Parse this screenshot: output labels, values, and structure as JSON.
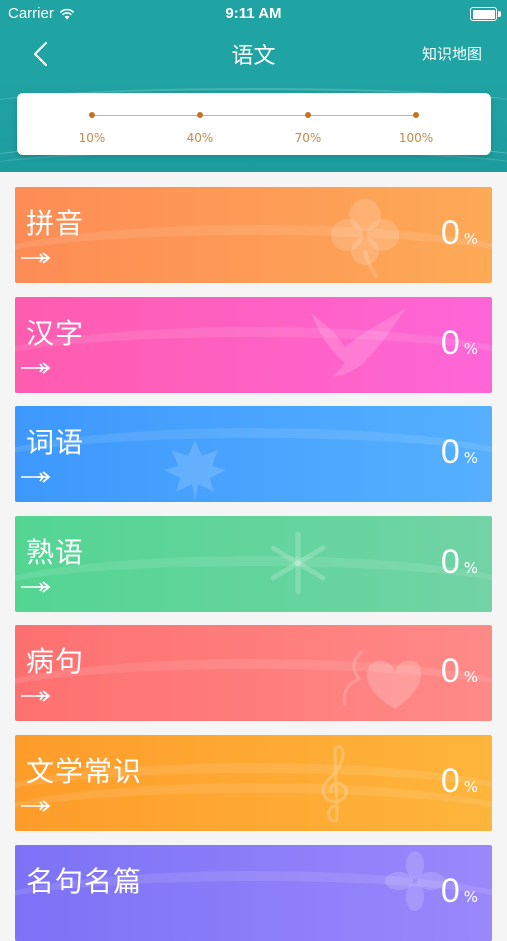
{
  "status_bar": {
    "carrier": "Carrier",
    "time": "9:11 AM"
  },
  "nav": {
    "title": "语文",
    "right_button": "知识地图",
    "back_icon": "chevron-left-icon"
  },
  "progress_scale": {
    "labels": [
      "10%",
      "40%",
      "70%",
      "100%"
    ]
  },
  "categories": [
    {
      "name": "拼音",
      "percent": "0",
      "unit": "%",
      "color_start": "#fd8c55",
      "color_end": "#fdaa57",
      "icon": "clover-icon"
    },
    {
      "name": "汉字",
      "percent": "0",
      "unit": "%",
      "color_start": "#fe5cae",
      "color_end": "#fe66d8",
      "icon": "dove-icon"
    },
    {
      "name": "词语",
      "percent": "0",
      "unit": "%",
      "color_start": "#3d98fd",
      "color_end": "#56b0fe",
      "icon": "maple-leaf-icon"
    },
    {
      "name": "熟语",
      "percent": "0",
      "unit": "%",
      "color_start": "#53d592",
      "color_end": "#72d3a6",
      "icon": "snowflake-icon"
    },
    {
      "name": "病句",
      "percent": "0",
      "unit": "%",
      "color_start": "#fe7070",
      "color_end": "#fe8a88",
      "icon": "heart-icon"
    },
    {
      "name": "文学常识",
      "percent": "0",
      "unit": "%",
      "color_start": "#fe9c2a",
      "color_end": "#feb53b",
      "icon": "treble-clef-icon"
    },
    {
      "name": "名句名篇",
      "percent": "0",
      "unit": "%",
      "color_start": "#7d72f6",
      "color_end": "#9a88fb",
      "icon": "flower-icon"
    }
  ]
}
